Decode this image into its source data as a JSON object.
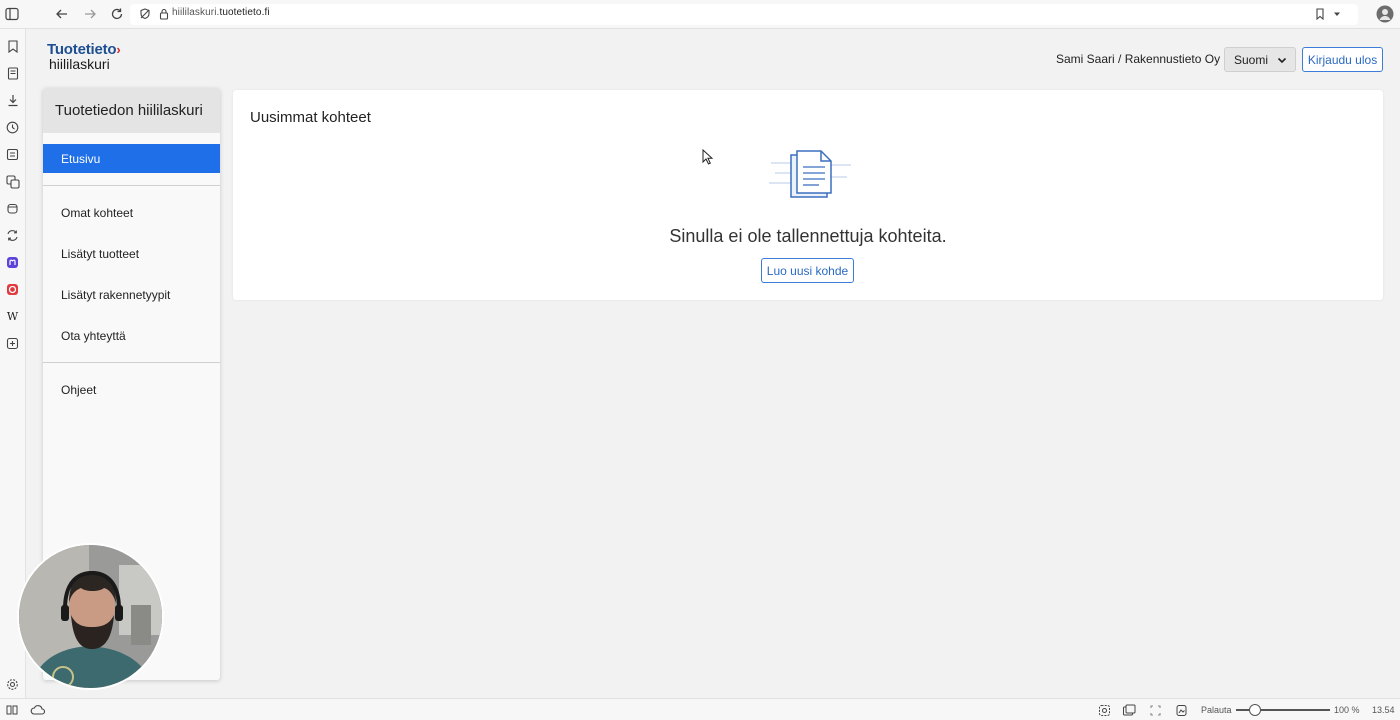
{
  "browser": {
    "url_prefix": "hiililaskuri.",
    "url_domain": "tuotetieto.fi",
    "status": {
      "reset_label": "Palauta",
      "zoom": "100 %",
      "time": "13.54"
    }
  },
  "header": {
    "logo_top": "Tuotetieto",
    "logo_bottom": "hiililaskuri",
    "user": "Sami Saari / Rakennustieto Oy",
    "language": "Suomi",
    "logout": "Kirjaudu ulos"
  },
  "sidebar": {
    "title": "Tuotetiedon hiililaskuri",
    "items": [
      {
        "label": "Etusivu",
        "active": true
      },
      {
        "label": "Omat kohteet"
      },
      {
        "label": "Lisätyt tuotteet"
      },
      {
        "label": "Lisätyt rakennetyypit"
      },
      {
        "label": "Ota yhteyttä"
      },
      {
        "label": "Ohjeet"
      }
    ]
  },
  "main": {
    "card_title": "Uusimmat kohteet",
    "empty_message": "Sinulla ei ole tallennettuja kohteita.",
    "create_button": "Luo uusi kohde"
  },
  "colors": {
    "accent": "#1e6fe8",
    "brand_blue": "#1d4f91",
    "brand_red": "#d6282e"
  }
}
